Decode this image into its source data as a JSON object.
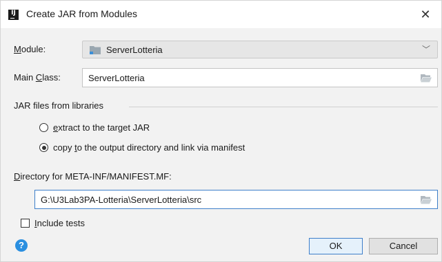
{
  "window": {
    "title": "Create JAR from Modules",
    "app_icon_text": "IJ",
    "close_glyph": "✕"
  },
  "module": {
    "label_prefix": "M",
    "label_rest": "odule:",
    "value": "ServerLotteria",
    "dropdown_glyph": "﹀"
  },
  "main_class": {
    "label_prefix": "Main ",
    "label_underlined": "C",
    "label_rest": "lass:",
    "value": "ServerLotteria"
  },
  "libraries": {
    "group_title": "JAR files from libraries",
    "options": [
      {
        "underlined": "e",
        "rest": "xtract to the target JAR",
        "selected": false
      },
      {
        "prefix": "copy ",
        "underlined": "t",
        "rest": "o the output directory and link via manifest",
        "selected": true
      }
    ]
  },
  "manifest_dir": {
    "label_underlined": "D",
    "label_rest": "irectory for META-INF/MANIFEST.MF:",
    "value": "G:\\U3Lab3PA-Lotteria\\ServerLotteria\\src"
  },
  "include_tests": {
    "underlined": "I",
    "rest": "nclude tests",
    "checked": false
  },
  "buttons": {
    "help": "?",
    "ok": "OK",
    "cancel": "Cancel"
  },
  "colors": {
    "accent": "#3d7ec9",
    "help": "#2a8fe0",
    "dialog_bg": "#f2f2f2"
  }
}
